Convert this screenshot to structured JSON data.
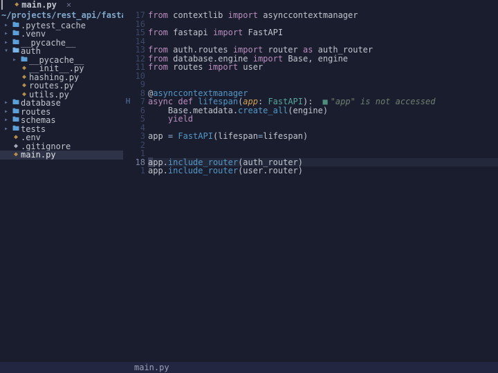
{
  "tab": {
    "filename": "main.py",
    "close": "×"
  },
  "sidebar": {
    "title": "~/projects/rest_api/fastapi/",
    "items": [
      {
        "indent": 0,
        "chev": "▸",
        "icon": "folder",
        "label": ".pytest_cache"
      },
      {
        "indent": 0,
        "chev": "▸",
        "icon": "folder",
        "label": ".venv"
      },
      {
        "indent": 0,
        "chev": "▸",
        "icon": "folder",
        "label": "__pycache__"
      },
      {
        "indent": 0,
        "chev": "▾",
        "icon": "folder-o",
        "label": "auth"
      },
      {
        "indent": 1,
        "chev": "▸",
        "icon": "folder",
        "label": "__pycache__"
      },
      {
        "indent": 1,
        "chev": "",
        "icon": "py",
        "label": "__init__.py"
      },
      {
        "indent": 1,
        "chev": "",
        "icon": "py",
        "label": "hashing.py"
      },
      {
        "indent": 1,
        "chev": "",
        "icon": "py",
        "label": "routes.py"
      },
      {
        "indent": 1,
        "chev": "",
        "icon": "py",
        "label": "utils.py"
      },
      {
        "indent": 0,
        "chev": "▸",
        "icon": "folder",
        "label": "database"
      },
      {
        "indent": 0,
        "chev": "▸",
        "icon": "folder",
        "label": "routes"
      },
      {
        "indent": 0,
        "chev": "▸",
        "icon": "folder",
        "label": "schemas"
      },
      {
        "indent": 0,
        "chev": "▸",
        "icon": "folder",
        "label": "tests"
      },
      {
        "indent": 0,
        "chev": "",
        "icon": "env",
        "label": ".env"
      },
      {
        "indent": 0,
        "chev": "",
        "icon": "git",
        "label": ".gitignore"
      },
      {
        "indent": 0,
        "chev": "",
        "icon": "py",
        "label": "main.py",
        "selected": true
      }
    ]
  },
  "status": {
    "text": "main.py"
  },
  "code": {
    "lines": [
      {
        "num": "17",
        "tokens": [
          [
            "kw",
            "from"
          ],
          [
            "id",
            " contextlib "
          ],
          [
            "kw",
            "import"
          ],
          [
            "id",
            " asynccontextmanager"
          ]
        ]
      },
      {
        "num": "16",
        "tokens": []
      },
      {
        "num": "15",
        "tokens": [
          [
            "kw",
            "from"
          ],
          [
            "id",
            " fastapi "
          ],
          [
            "kw",
            "import"
          ],
          [
            "id",
            " FastAPI"
          ]
        ]
      },
      {
        "num": "14",
        "tokens": []
      },
      {
        "num": "13",
        "tokens": [
          [
            "kw",
            "from"
          ],
          [
            "id",
            " auth.routes "
          ],
          [
            "kw",
            "import"
          ],
          [
            "id",
            " router "
          ],
          [
            "kw",
            "as"
          ],
          [
            "id",
            " auth_router"
          ]
        ]
      },
      {
        "num": "12",
        "tokens": [
          [
            "kw",
            "from"
          ],
          [
            "id",
            " database.engine "
          ],
          [
            "kw",
            "import"
          ],
          [
            "id",
            " Base, engine"
          ]
        ]
      },
      {
        "num": "11",
        "tokens": [
          [
            "kw",
            "from"
          ],
          [
            "id",
            " routes "
          ],
          [
            "kw",
            "import"
          ],
          [
            "id",
            " user"
          ]
        ]
      },
      {
        "num": "10",
        "tokens": []
      },
      {
        "num": "9",
        "tokens": []
      },
      {
        "num": "8",
        "tokens": [
          [
            "dec",
            "@"
          ],
          [
            "fn",
            "asynccontextmanager"
          ]
        ]
      },
      {
        "num": "7",
        "sign": "H",
        "tokens": [
          [
            "kw",
            "async def"
          ],
          [
            "id",
            " "
          ],
          [
            "fn",
            "lifespan"
          ],
          [
            "id",
            "("
          ],
          [
            "par",
            "app"
          ],
          [
            "id",
            ": "
          ],
          [
            "ty",
            "FastAPI"
          ],
          [
            "id",
            "):"
          ]
        ],
        "hint": "\"app\" is not accessed"
      },
      {
        "num": "6",
        "tokens": [
          [
            "id",
            "    Base.metadata."
          ],
          [
            "fn",
            "create_all"
          ],
          [
            "id",
            "(engine)"
          ]
        ]
      },
      {
        "num": "5",
        "tokens": [
          [
            "id",
            "    "
          ],
          [
            "kw",
            "yield"
          ]
        ]
      },
      {
        "num": "4",
        "tokens": []
      },
      {
        "num": "3",
        "tokens": [
          [
            "id",
            "app "
          ],
          [
            "op",
            "="
          ],
          [
            "id",
            " "
          ],
          [
            "fn",
            "FastAPI"
          ],
          [
            "id",
            "(lifespan"
          ],
          [
            "op",
            "="
          ],
          [
            "id",
            "lifespan)"
          ]
        ]
      },
      {
        "num": "2",
        "tokens": []
      },
      {
        "num": "1",
        "tokens": []
      },
      {
        "num": "18",
        "hot": true,
        "cursor": true,
        "tokens": [
          [
            "cursorbox",
            "a"
          ],
          [
            "id",
            "pp."
          ],
          [
            "fn",
            "include_router"
          ],
          [
            "id",
            "(auth_router)"
          ]
        ]
      },
      {
        "num": "1",
        "tokens": [
          [
            "id",
            "app."
          ],
          [
            "fn",
            "include_router"
          ],
          [
            "id",
            "(user.router)"
          ]
        ]
      }
    ]
  }
}
